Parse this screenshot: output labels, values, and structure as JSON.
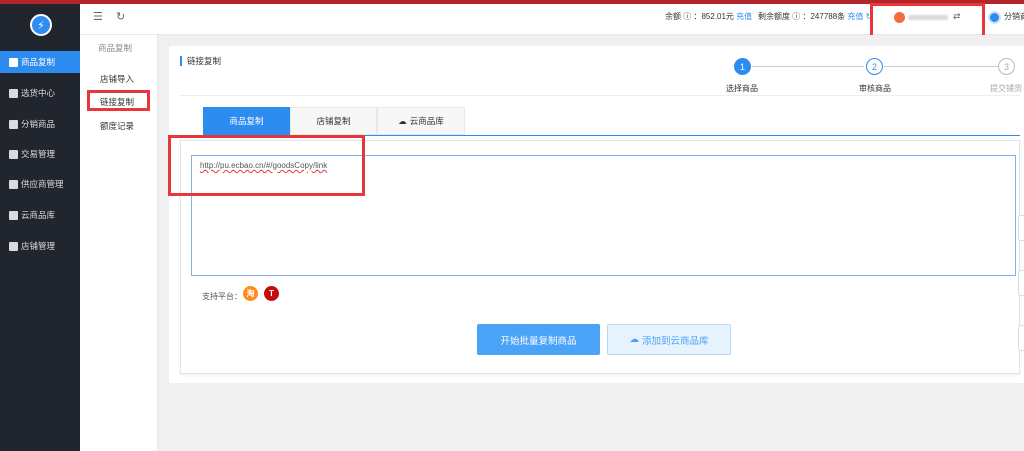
{
  "sidebar": {
    "items": [
      {
        "label": "商品复制",
        "icon": "copy-icon",
        "active": true
      },
      {
        "label": "选货中心",
        "icon": "shop-icon",
        "active": false
      },
      {
        "label": "分销商品",
        "icon": "bag-icon",
        "active": false
      },
      {
        "label": "交易管理",
        "icon": "order-icon",
        "active": false
      },
      {
        "label": "供应商管理",
        "icon": "supplier-icon",
        "active": false
      },
      {
        "label": "云商品库",
        "icon": "cloud-icon",
        "active": false
      },
      {
        "label": "店铺管理",
        "icon": "store-icon",
        "active": false
      }
    ]
  },
  "subnav": {
    "title": "商品复制",
    "items": [
      "店铺导入",
      "链接复制",
      "额度记录"
    ]
  },
  "topbar": {
    "balance_label": "余额",
    "balance_value": "：852.01元",
    "recharge1": "充值",
    "quota_label": "剩余额度",
    "quota_value": "：247788条",
    "recharge2": "充值",
    "account_name": "分销商"
  },
  "card": {
    "title": "链接复制"
  },
  "steps": [
    {
      "num": "1",
      "label": "选择商品",
      "active": true
    },
    {
      "num": "2",
      "label": "审核商品",
      "active": false
    },
    {
      "num": "3",
      "label": "提交铺货",
      "active": false
    }
  ],
  "tabs": [
    {
      "label": "商品复制",
      "active": true
    },
    {
      "label": "店铺复制",
      "active": false
    },
    {
      "label": "云商品库",
      "active": false
    }
  ],
  "url_input": {
    "value": "http://pu.ecbao.cn/#/goodsCopy/link"
  },
  "platform": {
    "label": "支持平台："
  },
  "buttons": {
    "start": "开始批量复制商品",
    "add_cloud": "添加到云商品库"
  },
  "colors": {
    "accent": "#2d8cf0",
    "sidebar_bg": "#21252d",
    "highlight_box": "#e8373a",
    "top_stripe": "#b2262b"
  }
}
